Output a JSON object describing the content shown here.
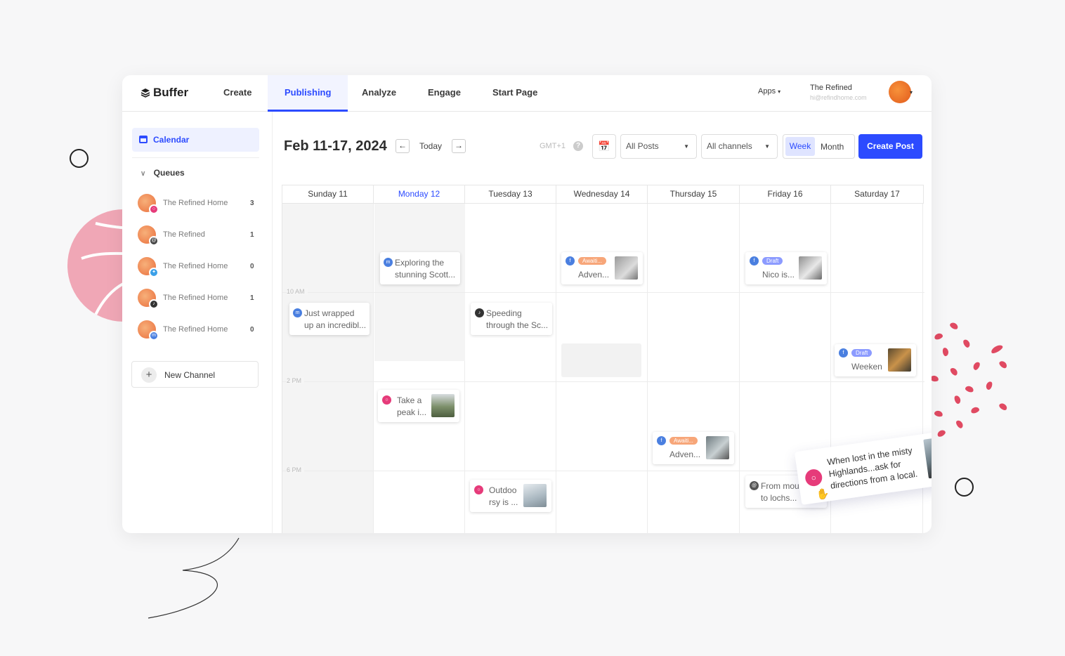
{
  "app": {
    "logo": "Buffer",
    "nav": [
      "Create",
      "Publishing",
      "Analyze",
      "Engage",
      "Start Page"
    ],
    "apps_label": "Apps",
    "account_name": "The Refined",
    "account_email": "hi@refindhome.com"
  },
  "sidebar": {
    "calendar_label": "Calendar",
    "queues_label": "Queues",
    "queues": [
      {
        "name": "The Refined Home",
        "count": "3",
        "channel": "instagram"
      },
      {
        "name": "The Refined",
        "count": "1",
        "channel": "threads"
      },
      {
        "name": "The Refined Home",
        "count": "0",
        "channel": "twitter"
      },
      {
        "name": "The Refined Home",
        "count": "1",
        "channel": "tiktok"
      },
      {
        "name": "The Refined Home",
        "count": "0",
        "channel": "mastodon"
      }
    ],
    "new_channel": "New Channel"
  },
  "calendar": {
    "range": "Feb 11-17, 2024",
    "today": "Today",
    "timezone": "GMT+1",
    "filter_posts": "All Posts",
    "filter_channels": "All channels",
    "view_week": "Week",
    "view_month": "Month",
    "create_post": "Create Post",
    "days": [
      "Sunday  11",
      "Monday  12",
      "Tuesday  13",
      "Wednesday  14",
      "Thursday  15",
      "Friday  16",
      "Saturday  17"
    ],
    "time_labels": [
      "10 AM",
      "2 PM",
      "6 PM"
    ]
  },
  "posts": {
    "mon_1": {
      "line1": "Exploring the",
      "line2": "stunning Scott..."
    },
    "wed_1": {
      "status": "Awaiti...",
      "line1": "Adven..."
    },
    "fri_1": {
      "status": "Draft",
      "line1": "Nico is..."
    },
    "sun_1": {
      "line1": "Just wrapped",
      "line2": "up an incredibl..."
    },
    "tue_1": {
      "line1": "Speeding",
      "line2": "through the Sc..."
    },
    "sat_1": {
      "status": "Draft",
      "line1": "Weeken"
    },
    "mon_2": {
      "line1": "Take a",
      "line2": "peak i..."
    },
    "thu_1": {
      "status": "Awaiti...",
      "line1": "Adven..."
    },
    "fri_2": {
      "line1": "From mountains",
      "line2": "to lochs..."
    },
    "tue_2": {
      "line1": "Outdoo",
      "line2": "rsy is ..."
    },
    "dragging": {
      "line1": "When lost in the misty",
      "line2": "Highlands...ask for",
      "line3": "directions from a local."
    }
  },
  "colors": {
    "accent": "#2c4bff",
    "facebook": "#4a7fe0",
    "instagram": "#e63b7a",
    "draft_pill": "#8c9bff",
    "awaiting_pill": "#f7a679"
  }
}
